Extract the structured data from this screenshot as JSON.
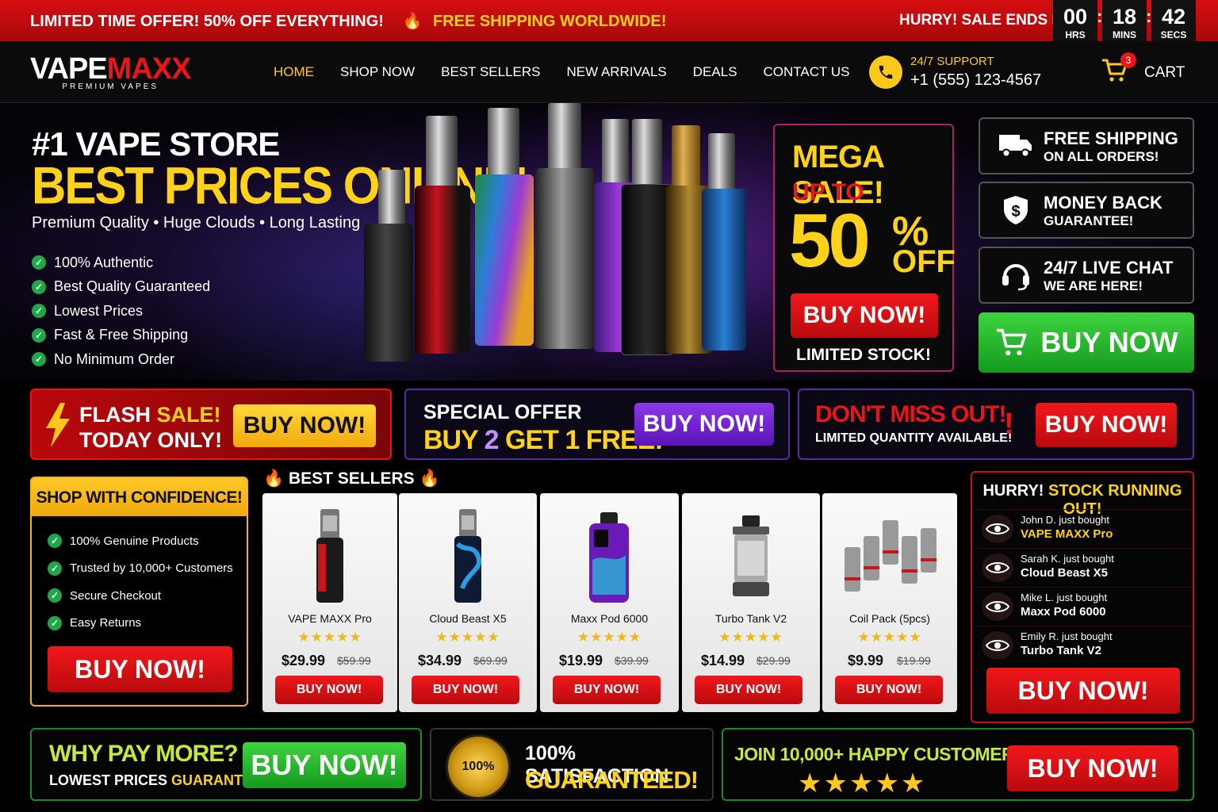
{
  "topbar": {
    "offer": "LIMITED TIME OFFER! 50% OFF EVERYTHING!",
    "shipping": "FREE SHIPPING WORLDWIDE!",
    "hurry": "HURRY! SALE ENDS IN:",
    "countdown": {
      "hrs": "00",
      "mins": "18",
      "secs": "42",
      "hrs_label": "HRS",
      "mins_label": "MINS",
      "secs_label": "SECS"
    }
  },
  "nav": {
    "logo_a": "VAPE",
    "logo_b": "MAXX",
    "logo_sub": "PREMIUM VAPES",
    "links": [
      "HOME",
      "SHOP NOW",
      "BEST SELLERS",
      "NEW ARRIVALS",
      "DEALS",
      "CONTACT US"
    ],
    "support_label": "24/7 SUPPORT",
    "phone": "+1 (555) 123-4567",
    "cart_count": "3",
    "cart_label": "CART"
  },
  "hero": {
    "title": "#1 VAPE STORE",
    "headline": "BEST PRICES ONLINE!",
    "tagline": "Premium Quality • Huge Clouds • Long Lasting",
    "checks": [
      "100% Authentic",
      "Best Quality Guaranteed",
      "Lowest Prices",
      "Fast & Free Shipping",
      "No Minimum Order"
    ]
  },
  "mega": {
    "title": "MEGA SALE!",
    "upto": "UP TO",
    "percent": "50",
    "percent_sign": "%",
    "off": "OFF",
    "button": "BUY NOW!",
    "note": "LIMITED STOCK!"
  },
  "features": [
    {
      "line1": "FREE SHIPPING",
      "line2": "ON ALL ORDERS!",
      "icon": "truck-icon"
    },
    {
      "line1": "MONEY BACK",
      "line2": "GUARANTEE!",
      "icon": "shield-dollar-icon"
    },
    {
      "line1": "24/7 LIVE CHAT",
      "line2": "WE ARE HERE!",
      "icon": "headset-icon"
    }
  ],
  "green_button": "BUY NOW",
  "promos": {
    "flash_a": "FLASH",
    "flash_b": "SALE!",
    "flash_c": "TODAY ONLY!",
    "flash_button": "BUY NOW!",
    "special_a": "SPECIAL OFFER",
    "special_b1": "BUY ",
    "special_b2": "2",
    "special_b3": " GET 1 FREE!",
    "special_button": "BUY NOW!",
    "miss_a": "DON'T MISS OUT!",
    "miss_b": "LIMITED QUANTITY AVAILABLE!",
    "miss_button": "BUY NOW!"
  },
  "confidence": {
    "title": "SHOP WITH CONFIDENCE!",
    "items": [
      "100% Genuine Products",
      "Trusted by 10,000+ Customers",
      "Secure Checkout",
      "Easy Returns"
    ],
    "button": "BUY NOW!"
  },
  "best_sellers": {
    "title": "BEST SELLERS",
    "products": [
      {
        "name": "VAPE MAXX Pro",
        "price": "$29.99",
        "old": "$59.99",
        "stars": "★★★★★",
        "rating": 4.5,
        "button": "BUY NOW!",
        "color": "#c4161c"
      },
      {
        "name": "Cloud Beast X5",
        "price": "$34.99",
        "old": "$69.99",
        "stars": "★★★★★",
        "rating": 4.5,
        "button": "BUY NOW!",
        "color": "#2a7fd6"
      },
      {
        "name": "Maxx Pod 6000",
        "price": "$19.99",
        "old": "$39.99",
        "stars": "★★★★★",
        "rating": 4.5,
        "button": "BUY NOW!",
        "color": "#7a2ad6"
      },
      {
        "name": "Turbo Tank V2",
        "price": "$14.99",
        "old": "$29.99",
        "stars": "★★★★★",
        "rating": 4.5,
        "button": "BUY NOW!",
        "color": "#888888"
      },
      {
        "name": "Coil Pack (5pcs)",
        "price": "$9.99",
        "old": "$19.99",
        "stars": "★★★★★",
        "rating": 4.5,
        "button": "BUY NOW!",
        "color": "#999999"
      }
    ]
  },
  "hurry_box": {
    "title_a": "HURRY!",
    "title_b": "STOCK RUNNING OUT!",
    "rows": [
      {
        "who": "John D. just bought",
        "product": "VAPE MAXX Pro",
        "highlight": true
      },
      {
        "who": "Sarah K. just bought",
        "product": "Cloud Beast X5",
        "highlight": false
      },
      {
        "who": "Mike L. just bought",
        "product": "Maxx Pod 6000",
        "highlight": false
      },
      {
        "who": "Emily R. just bought",
        "product": "Turbo Tank V2",
        "highlight": false
      }
    ],
    "button": "BUY NOW!"
  },
  "bottom": {
    "why_a": "WHY PAY MORE?",
    "why_b1": "LOWEST PRICES ",
    "why_b2": "GUARANTEED!",
    "why_button": "BUY NOW!",
    "seal_text": "100%",
    "sat_a": "100% SATISFACTION",
    "sat_b": "GUARANTEED!",
    "join_a": "JOIN 10,000+ HAPPY CUSTOMERS!",
    "join_stars": "★★★★★",
    "join_button": "BUY NOW!"
  },
  "colors": {
    "red": "#e8151a",
    "yellow": "#ffd21a",
    "green": "#1fa84a",
    "purple": "#5a2ca0"
  }
}
